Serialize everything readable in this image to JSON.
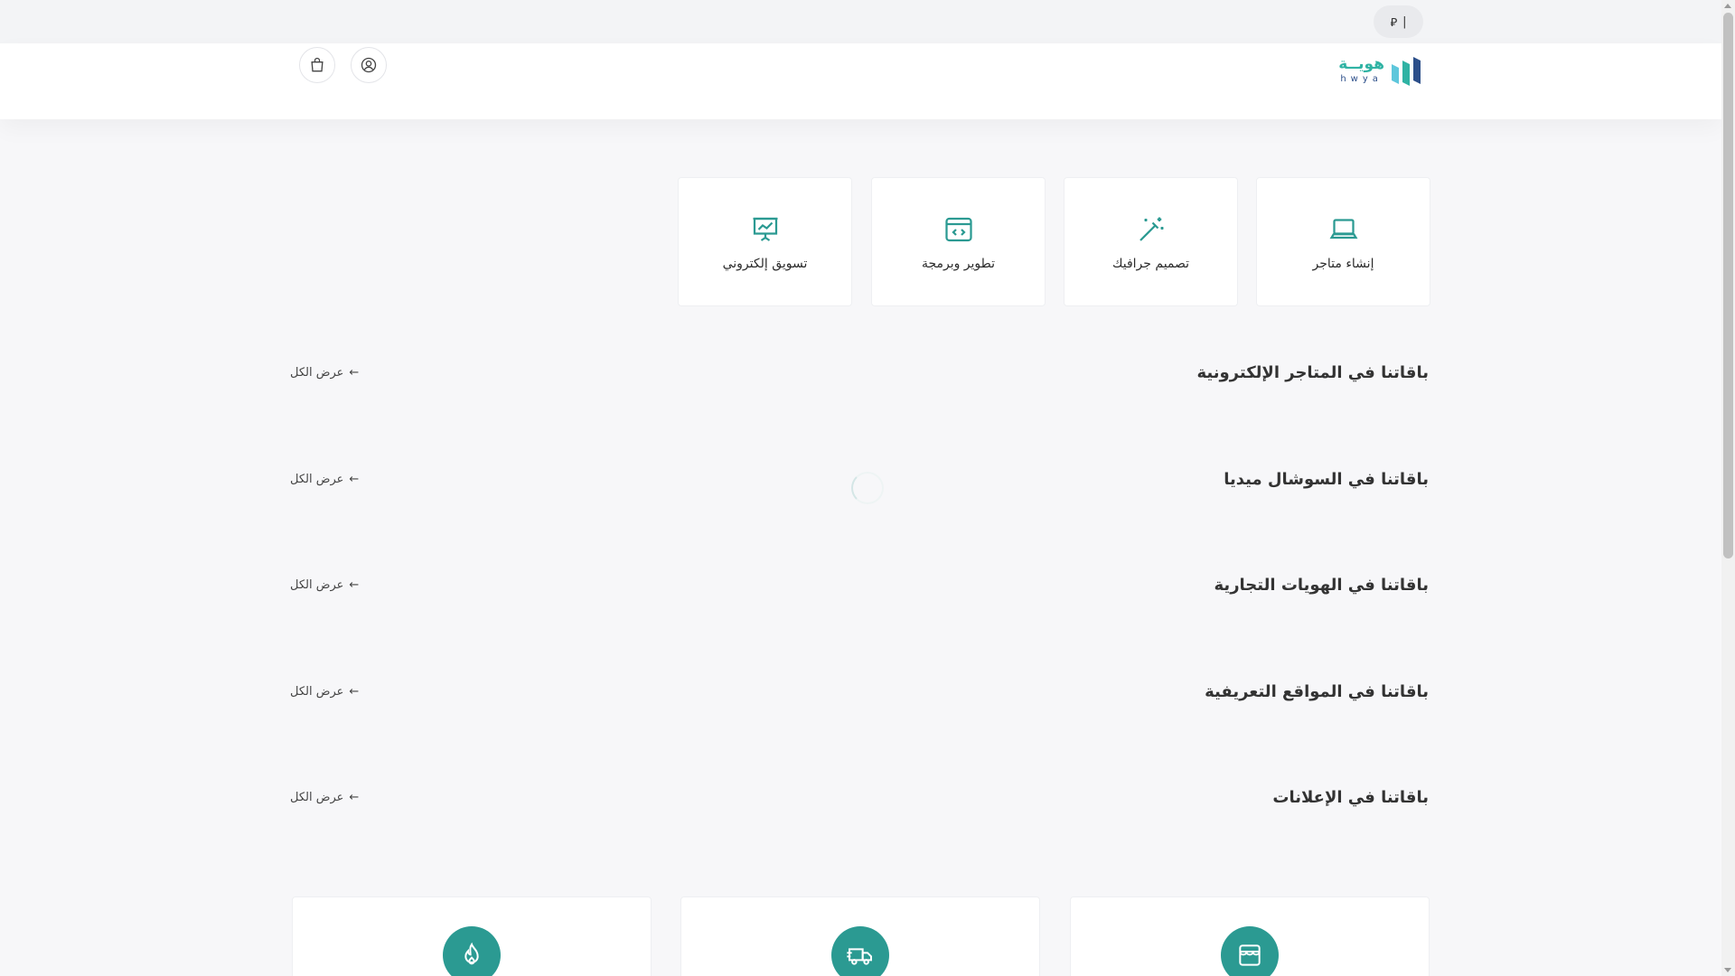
{
  "topbar": {
    "currency_symbol": "⃁",
    "divider": "|"
  },
  "header": {
    "logo": {
      "arabic": "هويــة",
      "latin": "hwya"
    },
    "account_icon": "user-circle-icon",
    "cart_icon": "shopping-bag-icon"
  },
  "categories": [
    {
      "label": "إنشاء متاجر",
      "icon": "laptop-icon"
    },
    {
      "label": "تصميم جرافيك",
      "icon": "magic-wand-icon"
    },
    {
      "label": "تطوير وبرمجة",
      "icon": "code-window-icon"
    },
    {
      "label": "تسويق إلكتروني",
      "icon": "presentation-chart-icon"
    }
  ],
  "sections": [
    {
      "title": "باقاتنا في المتاجر الإلكترونية",
      "view_all": "عرض الكل"
    },
    {
      "title": "باقاتنا في السوشال ميديا",
      "view_all": "عرض الكل"
    },
    {
      "title": "باقاتنا في الهويات التجارية",
      "view_all": "عرض الكل"
    },
    {
      "title": "باقاتنا في المواقع التعريفية",
      "view_all": "عرض الكل"
    },
    {
      "title": "باقاتنا في الإعلانات",
      "view_all": "عرض الكل"
    }
  ],
  "features": [
    {
      "icon": "store-icon"
    },
    {
      "icon": "delivery-truck-icon"
    },
    {
      "icon": "flame-icon"
    }
  ],
  "colors": {
    "accent": "#2fb3a4",
    "feature_bg": "#2b9a92",
    "brand_dark": "#2c4f8a"
  }
}
